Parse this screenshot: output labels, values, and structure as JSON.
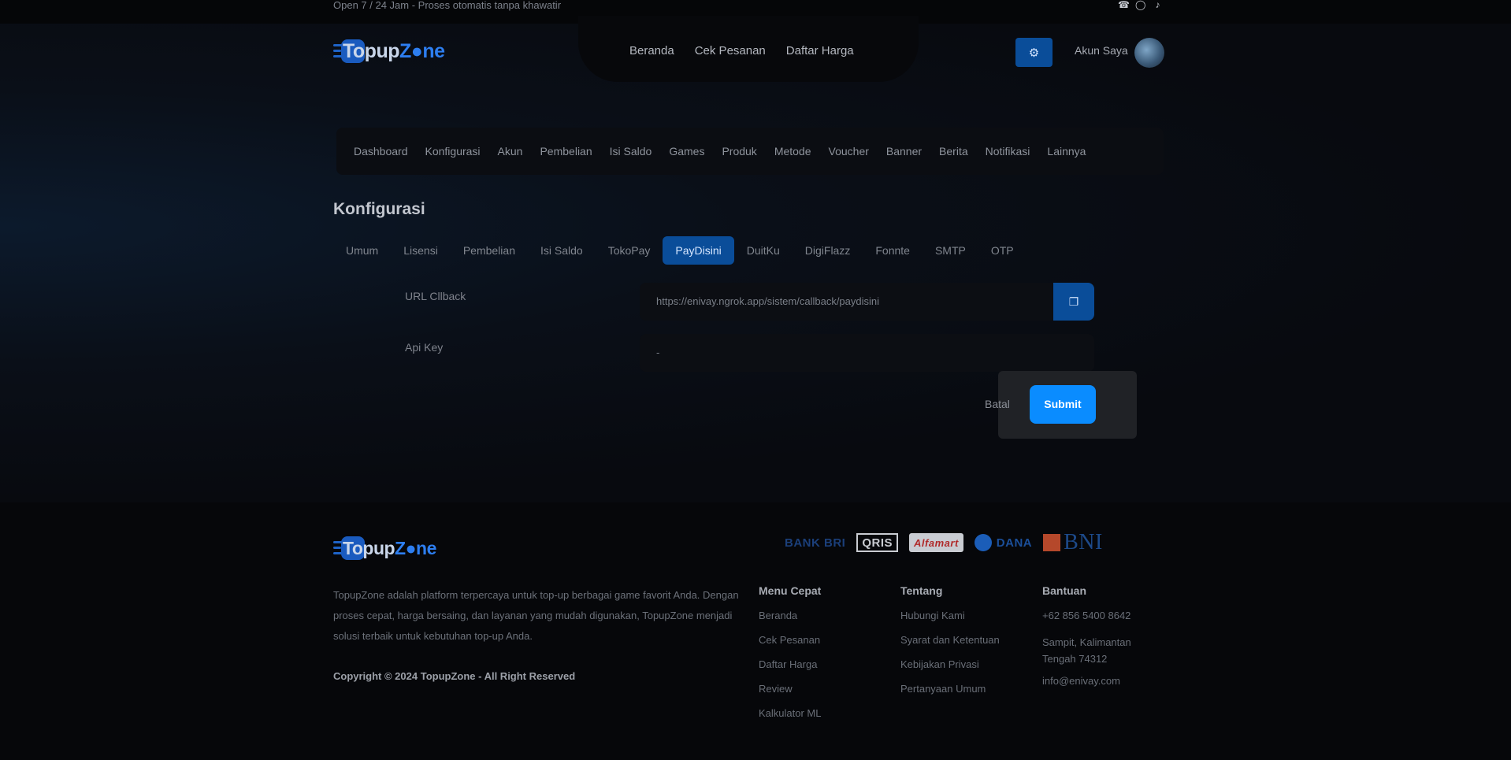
{
  "topbar": {
    "message": "Open 7 / 24 Jam - Proses otomatis tanpa khawatir",
    "socials": [
      "whatsapp-icon",
      "instagram-icon",
      "tiktok-icon"
    ]
  },
  "brand": {
    "name_a": "Topup",
    "name_z": "Z",
    "name_rest": "ne",
    "accent": "#2d7ef0"
  },
  "nav": {
    "items": [
      "Beranda",
      "Cek Pesanan",
      "Daftar Harga"
    ]
  },
  "account": {
    "label": "Akun Saya"
  },
  "admin_menu": {
    "items": [
      "Dashboard",
      "Konfigurasi",
      "Akun",
      "Pembelian",
      "Isi Saldo",
      "Games",
      "Produk",
      "Metode",
      "Voucher",
      "Banner",
      "Berita",
      "Notifikasi",
      "Lainnya"
    ]
  },
  "page": {
    "title": "Konfigurasi"
  },
  "tabs": {
    "items": [
      "Umum",
      "Lisensi",
      "Pembelian",
      "Isi Saldo",
      "TokoPay",
      "PayDisini",
      "DuitKu",
      "DigiFlazz",
      "Fonnte",
      "SMTP",
      "OTP"
    ],
    "active": "PayDisini"
  },
  "form": {
    "callback_label": "URL Cllback",
    "callback_value": "https://enivay.ngrok.app/sistem/callback/paydisini",
    "apikey_label": "Api Key",
    "apikey_value": "-",
    "cancel_label": "Batal",
    "submit_label": "Submit"
  },
  "footer": {
    "payments": [
      "BANK BRI",
      "QRIS",
      "Alfamart",
      "DANA",
      "BNI"
    ],
    "description": "TopupZone adalah platform terpercaya untuk top-up berbagai game favorit Anda. Dengan proses cepat, harga bersaing, dan layanan yang mudah digunakan, TopupZone menjadi solusi terbaik untuk kebutuhan top-up Anda.",
    "copyright": "Copyright © 2024 TopupZone - All Right Reserved",
    "menu_cepat": {
      "title": "Menu Cepat",
      "links": [
        "Beranda",
        "Cek Pesanan",
        "Daftar Harga",
        "Review",
        "Kalkulator ML"
      ]
    },
    "tentang": {
      "title": "Tentang",
      "links": [
        "Hubungi Kami",
        "Syarat dan Ketentuan",
        "Kebijakan Privasi",
        "Pertanyaan Umum"
      ]
    },
    "bantuan": {
      "title": "Bantuan",
      "phone": "+62 856 5400 8642",
      "address": "Sampit, Kalimantan Tengah 74312",
      "email": "info@enivay.com"
    }
  }
}
